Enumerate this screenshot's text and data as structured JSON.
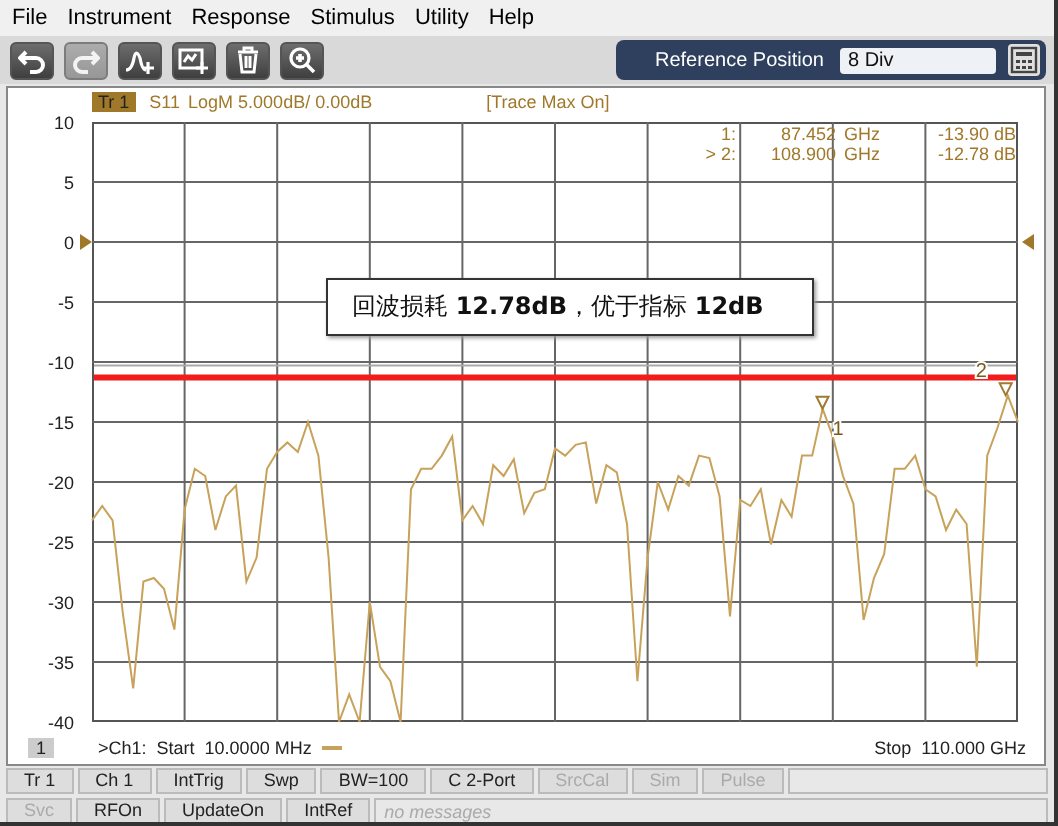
{
  "menu": [
    "File",
    "Instrument",
    "Response",
    "Stimulus",
    "Utility",
    "Help"
  ],
  "toolbar_buttons": [
    {
      "disabled": false
    },
    {
      "disabled": true
    },
    {
      "disabled": false
    },
    {
      "disabled": false
    },
    {
      "disabled": false
    },
    {
      "disabled": false
    }
  ],
  "reference": {
    "label": "Reference Position",
    "value": "8 Div"
  },
  "trace_header": {
    "badge": "Tr 1",
    "text": "LogM 5.000dB/  0.00dB",
    "status": "[Trace Max On]"
  },
  "marker_readout": [
    {
      "label": "1:",
      "freq": "87.452",
      "unit": "GHz",
      "value": "-13.90 dB"
    },
    {
      "label": "> 2:",
      "freq": "108.900",
      "unit": "GHz",
      "value": "-12.78 dB"
    }
  ],
  "chart_data": {
    "type": "line",
    "grid": true,
    "ylim": [
      -40,
      10
    ],
    "ref_lines": [
      {
        "axis": "y",
        "value": -10.3,
        "color": "#aaaaaa"
      },
      {
        "axis": "y",
        "value": -11.3,
        "color": "#f21c1c"
      }
    ],
    "yticks": [
      10,
      5,
      0,
      -5,
      -10,
      -15,
      -20,
      -25,
      -30,
      -35,
      -40
    ],
    "categories": [
      null,
      null,
      null,
      null,
      null,
      null,
      null,
      null,
      null,
      null,
      null,
      null,
      null,
      null,
      null,
      null,
      null,
      null,
      null,
      null,
      null,
      null,
      null,
      null,
      null,
      null,
      null,
      null,
      null,
      null,
      null,
      null,
      null,
      null,
      null,
      null,
      null,
      null,
      null,
      null,
      null,
      null,
      null,
      null,
      null,
      null,
      null,
      null,
      null,
      null,
      null,
      null,
      null,
      null,
      null,
      null,
      null,
      null,
      null,
      null,
      null,
      null,
      null,
      null,
      null,
      null,
      null,
      null,
      null,
      null,
      null,
      null,
      null,
      null,
      null,
      null,
      null,
      null,
      null,
      null,
      null,
      null,
      null,
      null,
      null,
      null,
      null,
      null,
      null,
      null,
      null
    ],
    "series": [
      {
        "name": "S11",
        "color": "#c8a25a",
        "values": [
          -23.2,
          -22,
          -23.2,
          -30.9,
          -37.2,
          -28.3,
          -28,
          -28.9,
          -32.3,
          -22.3,
          -18.9,
          -19.5,
          -24,
          -21.2,
          -20.3,
          -28.3,
          -26.3,
          -18.9,
          -17.5,
          -16.7,
          -17.5,
          -15,
          -17.8,
          -26.3,
          -40,
          -37.7,
          -40,
          -30,
          -35.4,
          -36.6,
          -40,
          -20.6,
          -18.9,
          -18.9,
          -17.8,
          -16.2,
          -23.2,
          -22,
          -23.5,
          -18.6,
          -19.5,
          -18.1,
          -22.6,
          -20.9,
          -20.6,
          -17.2,
          -17.8,
          -16.9,
          -16.7,
          -21.8,
          -18.6,
          -19.2,
          -23.5,
          -36.6,
          -26.3,
          -20,
          -22.3,
          -19.5,
          -20.3,
          -17.8,
          -18,
          -21.2,
          -31.2,
          -21.5,
          -22,
          -20.6,
          -25.2,
          -21.5,
          -22.9,
          -17.8,
          -17.8,
          -13.9,
          -16.2,
          -19.5,
          -21.8,
          -31.5,
          -28,
          -26,
          -18.9,
          -18.9,
          -17.8,
          -20.6,
          -21.2,
          -24,
          -22.3,
          -23.5,
          -35.4,
          -17.8,
          -15.5,
          -12.8,
          -15
        ]
      }
    ]
  },
  "annotation": "回波损耗 **12.78dB**，优于指标 **12dB**",
  "trace_markers": [
    "1",
    "2"
  ],
  "channel_number": "1",
  "start": ">Ch1:  Start  10.0000 MHz",
  "stop": "Stop  110.000 GHz",
  "status_row1": [
    {
      "label": "Tr 1",
      "disabled": false
    },
    {
      "label": "Ch 1",
      "disabled": false
    },
    {
      "label": "IntTrig",
      "disabled": false
    },
    {
      "label": "Swp",
      "disabled": false
    },
    {
      "label": "BW=100",
      "disabled": false
    },
    {
      "label": "C  2-Port",
      "disabled": false
    },
    {
      "label": "SrcCal",
      "disabled": true
    },
    {
      "label": "Sim",
      "disabled": true
    },
    {
      "label": "Pulse",
      "disabled": true
    }
  ],
  "status_row2": [
    {
      "label": "Svc",
      "disabled": true
    },
    {
      "label": "RFOn",
      "disabled": false
    },
    {
      "label": "UpdateOn",
      "disabled": false
    },
    {
      "label": "IntRef",
      "disabled": false
    }
  ],
  "message_placeholder": "no messages"
}
